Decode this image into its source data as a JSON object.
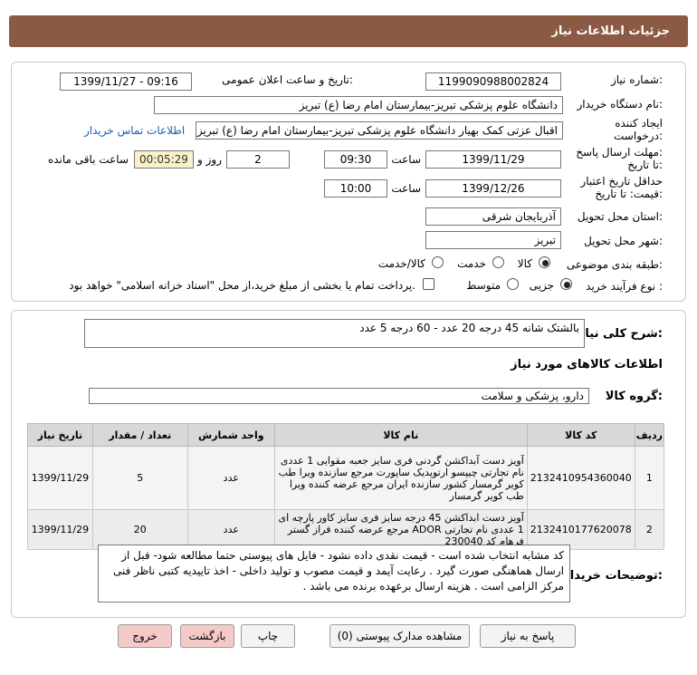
{
  "header": {
    "title": "جزئیات اطلاعات نیاز"
  },
  "fields": {
    "need_number_label": "شماره نیاز:",
    "need_number": "1199090988002824",
    "announce_label": "تاریخ و ساعت اعلان عمومی:",
    "announce_value": "1399/11/27 - 09:16",
    "buyer_label": "نام دستگاه خریدار:",
    "buyer_value": "دانشگاه علوم پزشکی تبریز-بیمارستان امام رضا (ع) تبریز",
    "creator_label_1": "ایجاد کننده",
    "creator_label_2": "درخواست:",
    "creator_value": "اقبال عزتی کمک بهیار دانشگاه علوم پزشکی تبریز-بیمارستان امام رضا (ع) تبریز",
    "contact_link": "اطلاعات تماس خریدار",
    "deadline_label_1": "مهلت ارسال پاسخ:",
    "deadline_label_2": "تا تاریخ:",
    "deadline_date": "1399/11/29",
    "time_label": "ساعت",
    "deadline_time": "09:30",
    "days_value": "2",
    "days_label": "روز و",
    "remaining_time": "00:05:29",
    "remaining_label": "ساعت باقی مانده",
    "validity_label_1": "حداقل تاریخ اعتبار",
    "validity_label_2": "قیمت: تا تاریخ:",
    "validity_date": "1399/12/26",
    "validity_time_label": "ساعت",
    "validity_time": "10:00",
    "province_label": "استان محل تحویل:",
    "province_value": "آذربایجان شرقی",
    "city_label": "شهر محل تحویل:",
    "city_value": "تبریز",
    "category_label": "طبقه بندی موضوعی:",
    "category_options": [
      "کالا",
      "خدمت",
      "کالا/خدمت"
    ],
    "process_label": "نوع فرآیند خرید :",
    "process_options": [
      "جزیی",
      "متوسط"
    ],
    "payment_note": "پرداخت تمام یا بخشی از مبلغ خرید،از محل \"اسناد خزانه اسلامی\" خواهد بود."
  },
  "summary": {
    "label": "شرح کلی نیاز:",
    "value": "بالشتک شانه 45 درجه 20 عدد - 60 درجه 5 عدد"
  },
  "goods_info": {
    "title": "اطلاعات کالاهای مورد نیاز"
  },
  "goods_group": {
    "label": "گروه کالا:",
    "value": "دارو، پزشکی و سلامت"
  },
  "table": {
    "headers": [
      "ردیف",
      "کد کالا",
      "نام کالا",
      "واحد شمارش",
      "تعداد / مقدار",
      "تاریخ نیاز"
    ],
    "rows": [
      {
        "row": "1",
        "code": "2132410954360040",
        "name": "آویز دست آبداکشن گردنی فری سایز جعبه مقوایی 1 عددی نام تجارتی چیپسو ارتوپدیک ساپورت مرجع سازنده ویرا طب کویر گرمسار کشور سازنده ایران مرجع عرضه کننده ویرا طب کویر گرمسار",
        "unit": "عدد",
        "qty": "5",
        "date": "1399/11/29"
      },
      {
        "row": "2",
        "code": "2132410177620078",
        "name": "آویز دست ابداکشن 45 درجه سایز فری سایز کاور پارچه ای 1 عددی نام تجارتی ADOR مرجع عرضه کننده فراز گستر فرهام کد 230040",
        "unit": "عدد",
        "qty": "20",
        "date": "1399/11/29"
      }
    ]
  },
  "notes": {
    "label": "توضیحات خریدار:",
    "value": "کد مشابه انتخاب شده است - قیمت نقدی داده نشود - فایل های پیوستی حتما مطالعه شود- قبل از ارسال هماهنگی صورت گیرد . رعایت آیمد و قیمت مصوب و تولید داخلی -  اخذ تاییدیه کتبی ناظر فنی مرکز الزامی است . هزینه ارسال برعهده برنده می باشد ."
  },
  "buttons": {
    "reply": "پاسخ به نیاز",
    "attachments": "مشاهده مدارک پیوستی (0)",
    "print": "چاپ",
    "back": "بازگشت",
    "exit": "خروج"
  }
}
